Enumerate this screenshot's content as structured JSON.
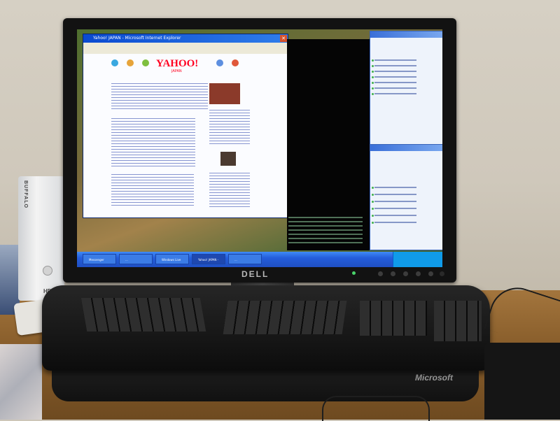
{
  "monitor": {
    "brand": "DELL"
  },
  "ie_window": {
    "title": "Yahoo! JAPAN - Microsoft Internet Explorer",
    "logo": "YAHOO!",
    "logo_sub": "JAPAN"
  },
  "taskbar": {
    "items": [
      "Messenger",
      "...",
      "Windows Live Messenger",
      "Yahoo! JAPAN - Microsoft...",
      "..."
    ]
  },
  "keyboard": {
    "brand": "Microsoft"
  },
  "external_drive": {
    "brand": "BUFFALO",
    "model": "HD"
  },
  "colors": {
    "xp_blue": "#245ddb",
    "yahoo_red": "#ff0020",
    "desk": "#8a5f2c"
  }
}
